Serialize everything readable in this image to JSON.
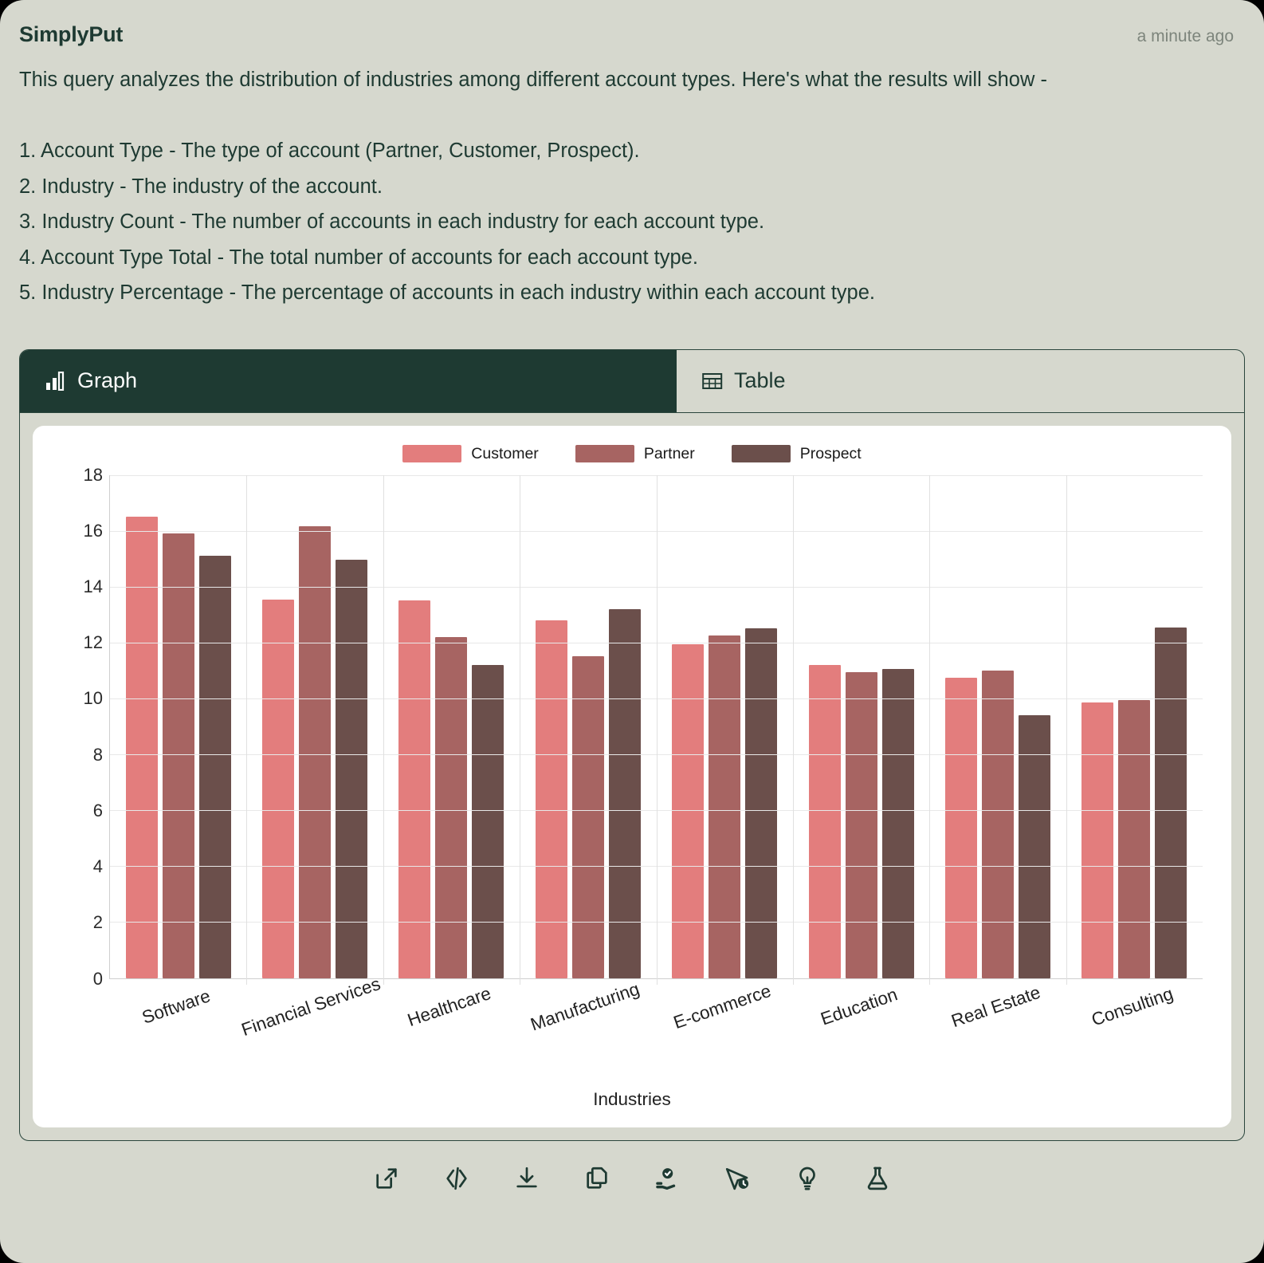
{
  "header": {
    "app_title": "SimplyPut",
    "timestamp": "a minute ago"
  },
  "message": {
    "intro": "This query analyzes the distribution of industries among different account types. Here's what the results will show -",
    "items": [
      "1. Account Type - The type of account (Partner, Customer, Prospect).",
      "2. Industry - The industry of the account.",
      "3. Industry Count - The number of accounts in each industry for each account type.",
      "4. Account Type Total - The total number of accounts for each account type.",
      "5. Industry Percentage - The percentage of accounts in each industry within each account type."
    ]
  },
  "tabs": [
    {
      "label": "Graph",
      "icon": "bar-chart-icon",
      "active": true
    },
    {
      "label": "Table",
      "icon": "table-icon",
      "active": false
    }
  ],
  "colors": {
    "page_background": "#000000",
    "card_background": "#D6D8CE",
    "accent_dark_green": "#1E3A32",
    "panel_background": "#FFFFFF",
    "customer": "#E37D7D",
    "partner": "#A76462",
    "prospect": "#6B4F4B"
  },
  "actions": [
    {
      "name": "open-external-button",
      "icon": "external-link-icon",
      "label": "Open in new tab"
    },
    {
      "name": "view-code-button",
      "icon": "code-icon",
      "label": "View code"
    },
    {
      "name": "download-button",
      "icon": "download-icon",
      "label": "Download"
    },
    {
      "name": "copy-button",
      "icon": "copy-icon",
      "label": "Copy"
    },
    {
      "name": "verify-button",
      "icon": "hand-badge-check-icon",
      "label": "Verify"
    },
    {
      "name": "send-later-button",
      "icon": "cursor-clock-icon",
      "label": "Send later"
    },
    {
      "name": "suggestion-button",
      "icon": "lightbulb-icon",
      "label": "Suggestion"
    },
    {
      "name": "experiment-button",
      "icon": "flask-icon",
      "label": "Experiment"
    }
  ],
  "chart_data": {
    "type": "bar",
    "title": "",
    "xlabel": "Industries",
    "ylabel": "",
    "ylim": [
      0,
      18
    ],
    "yticks": [
      0,
      2,
      4,
      6,
      8,
      10,
      12,
      14,
      16,
      18
    ],
    "grid": true,
    "legend_position": "top-center",
    "categories": [
      "Software",
      "Financial Services",
      "Healthcare",
      "Manufacturing",
      "E-commerce",
      "Education",
      "Real Estate",
      "Consulting"
    ],
    "series": [
      {
        "name": "Customer",
        "color": "#E37D7D",
        "values": [
          16.5,
          13.55,
          13.5,
          12.8,
          11.95,
          11.2,
          10.75,
          9.85
        ]
      },
      {
        "name": "Partner",
        "color": "#A76462",
        "values": [
          15.9,
          16.15,
          12.2,
          11.5,
          12.25,
          10.95,
          11.0,
          9.95
        ]
      },
      {
        "name": "Prospect",
        "color": "#6B4F4B",
        "values": [
          15.1,
          14.95,
          11.2,
          13.2,
          12.5,
          11.05,
          9.4,
          12.55
        ]
      }
    ]
  }
}
